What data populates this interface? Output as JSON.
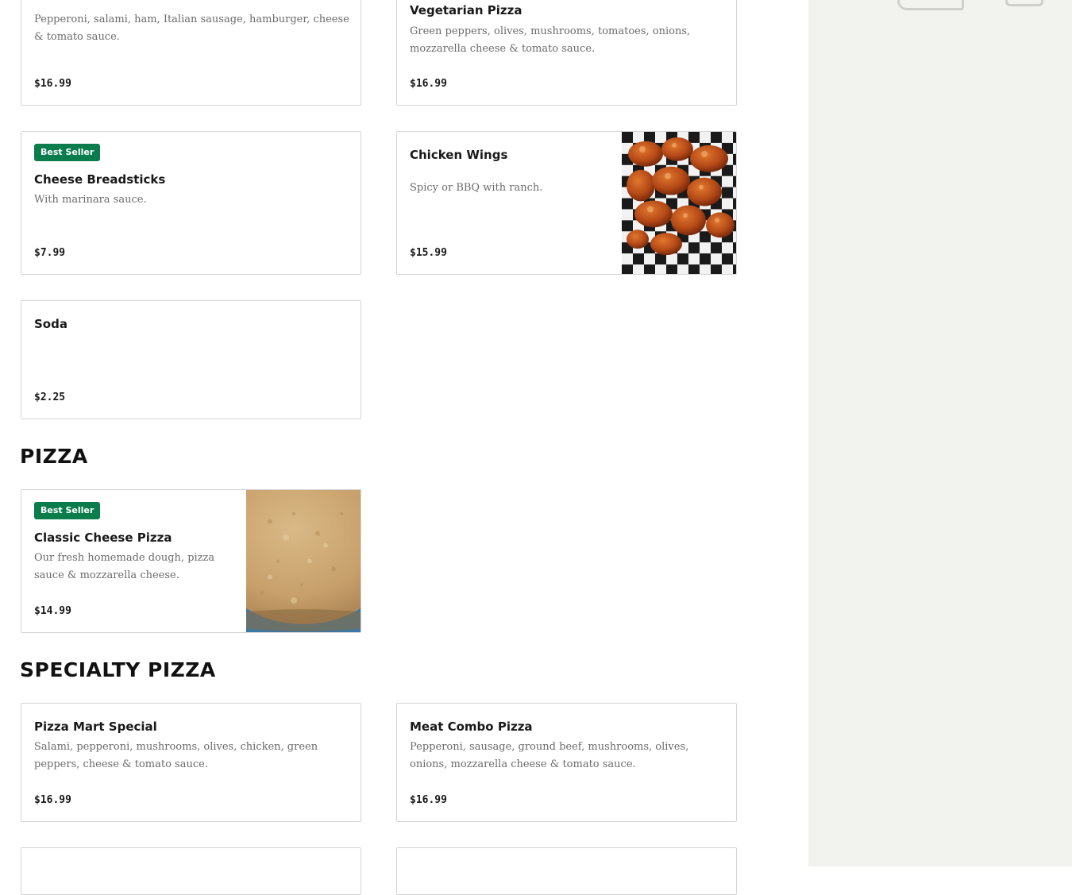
{
  "sections": {
    "pizza": "PIZZA",
    "specialty": "SPECIALTY PIZZA"
  },
  "items": {
    "meat_pizza": {
      "description": "Pepperoni, salami, ham, Italian sausage, hamburger, cheese & tomato sauce.",
      "price": "$16.99"
    },
    "vegetarian_pizza": {
      "name": "Vegetarian Pizza",
      "description": "Green peppers, olives, mushrooms, tomatoes, onions, mozzarella cheese & tomato sauce.",
      "price": "$16.99"
    },
    "cheese_breadsticks": {
      "badge": "Best Seller",
      "name": "Cheese Breadsticks",
      "description": "With marinara sauce.",
      "price": "$7.99"
    },
    "chicken_wings": {
      "name": "Chicken Wings",
      "description": "Spicy or BBQ with ranch.",
      "price": "$15.99",
      "image": "chicken-wings-photo"
    },
    "soda": {
      "name": "Soda",
      "price": "$2.25"
    },
    "classic_cheese_pizza": {
      "badge": "Best Seller",
      "name": "Classic Cheese Pizza",
      "description": "Our fresh homemade dough, pizza sauce & mozzarella cheese.",
      "price": "$14.99",
      "image": "cheese-pizza-photo"
    },
    "pizza_mart_special": {
      "name": "Pizza Mart Special",
      "description": "Salami, pepperoni, mushrooms, olives, chicken, green peppers, cheese & tomato sauce.",
      "price": "$16.99"
    },
    "meat_combo_pizza": {
      "name": "Meat Combo Pizza",
      "description": "Pepperoni, sausage, ground beef, mushrooms, olives, onions, mozzarella cheese & tomato sauce.",
      "price": "$16.99"
    }
  },
  "colors": {
    "badge": "#0b7d4d",
    "border": "#d5d5d5",
    "side_panel": "#f2f2ee"
  }
}
